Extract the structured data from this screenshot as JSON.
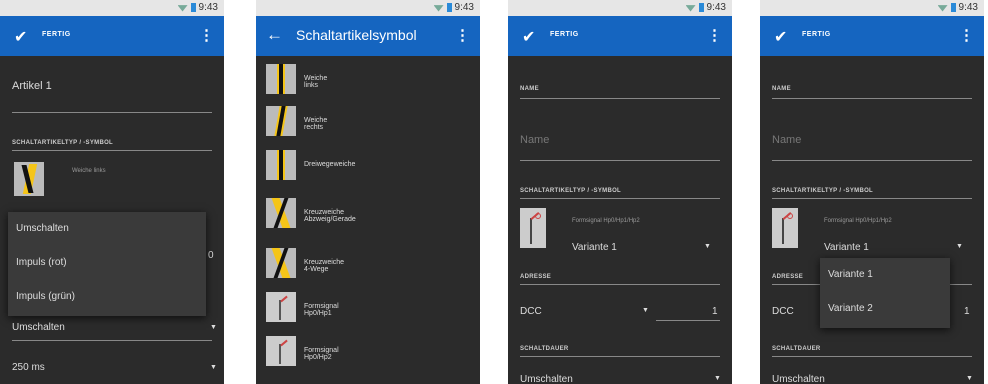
{
  "status": {
    "time": "9:43"
  },
  "screen1": {
    "appbar_title": "FERTIG",
    "article_name": "Artikel 1",
    "type_label": "SCHALTARTIKELTYP / -SYMBOL",
    "symbol_name": "Weiche links",
    "popup": [
      "Umschalten",
      "Impuls (rot)",
      "Impuls (grün)"
    ],
    "popup_right_value": "0",
    "dropdown1": "Umschalten",
    "dropdown2": "250 ms"
  },
  "screen2": {
    "appbar_title": "Schaltartikelsymbol",
    "items": [
      "Weiche links",
      "Weiche rechts",
      "Dreiwegeweiche",
      "Kreuzweiche Abzweig/Gerade",
      "Kreuzweiche 4-Wege",
      "Formsignal Hp0/Hp1",
      "Formsignal Hp0/Hp2"
    ]
  },
  "screen3": {
    "appbar_title": "FERTIG",
    "name_label": "NAME",
    "name_placeholder": "Name",
    "type_label": "SCHALTARTIKELTYP / -SYMBOL",
    "symbol_name": "Formsignal Hp0/Hp1/Hp2",
    "variant": "Variante 1",
    "address_label": "ADRESSE",
    "protocol": "DCC",
    "address_value": "1",
    "duration_label": "SCHALTDAUER",
    "duration_value": "Umschalten"
  },
  "screen4": {
    "appbar_title": "FERTIG",
    "name_label": "NAME",
    "name_placeholder": "Name",
    "type_label": "SCHALTARTIKELTYP / -SYMBOL",
    "symbol_name": "Formsignal Hp0/Hp1/Hp2",
    "variant": "Variante 1",
    "address_label": "ADRESSE",
    "protocol": "DCC",
    "address_value": "1",
    "duration_label": "SCHALTDAUER",
    "duration_value": "Umschalten",
    "popup": [
      "Variante 1",
      "Variante 2"
    ]
  },
  "colors": {
    "appbar": "#1565c0",
    "background": "#2b2b2b",
    "accent_yellow": "#f5c518"
  }
}
